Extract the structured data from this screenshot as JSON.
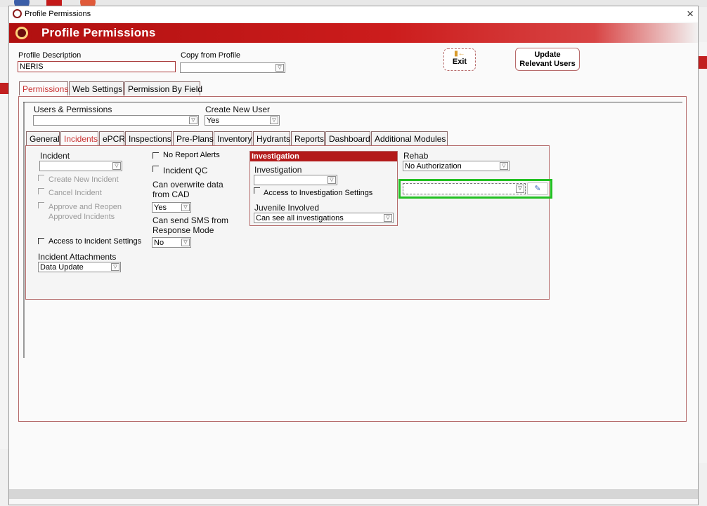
{
  "window": {
    "title": "Profile Permissions",
    "header": "Profile Permissions",
    "close_label": "×"
  },
  "fields": {
    "profile_description_label": "Profile Description",
    "profile_description_value": "NERIS",
    "copy_from_label": "Copy from Profile",
    "copy_from_value": ""
  },
  "buttons": {
    "exit_label": "Exit",
    "update_line1": "Update",
    "update_line2": "Relevant Users"
  },
  "main_tabs": [
    "Permissions",
    "Web Settings",
    "Permission By Field"
  ],
  "users": {
    "users_label": "Users & Permissions",
    "users_value": "",
    "create_label": "Create New User",
    "create_value": "Yes"
  },
  "sub_tabs": [
    "General",
    "Incidents",
    "ePCR",
    "Inspections",
    "Pre-Plans",
    "Inventory",
    "Hydrants",
    "Reports",
    "Dashboard",
    "Additional Modules"
  ],
  "incidents": {
    "incident_label": "Incident",
    "incident_value": "",
    "create_new": "Create New Incident",
    "cancel": "Cancel Incident",
    "approve_line1": "Approve and Reopen",
    "approve_line2": "Approved Incidents",
    "access_settings": "Access to Incident Settings",
    "attachments_label": "Incident Attachments",
    "attachments_value": "Data Update",
    "no_report_alerts": "No Report Alerts",
    "incident_qc": "Incident QC",
    "overwrite_line1": "Can overwrite data",
    "overwrite_line2": "from CAD",
    "overwrite_value": "Yes",
    "sms_line1": "Can send SMS from",
    "sms_line2": "Response Mode",
    "sms_value": "No"
  },
  "investigation": {
    "header": "Investigation",
    "label": "Investigation",
    "value": "",
    "access_settings": "Access to Investigation Settings",
    "juvenile_label": "Juvenile Involved",
    "juvenile_value": "Can see all investigations"
  },
  "rehab": {
    "label": "Rehab",
    "value": "No Authorization",
    "pencil_icon": "pencil-icon"
  },
  "colors": {
    "accent": "#c21f1f",
    "highlight": "#22c022"
  }
}
